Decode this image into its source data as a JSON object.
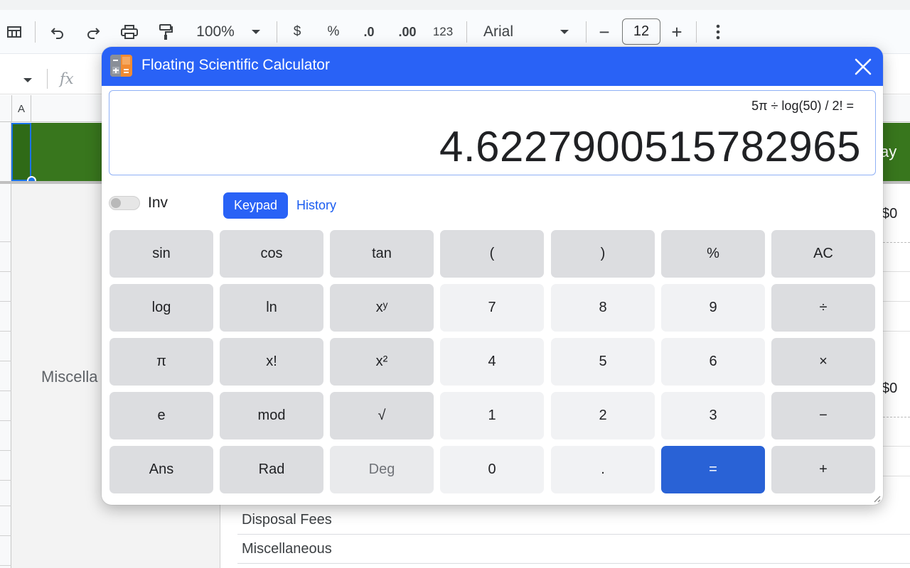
{
  "toolbar": {
    "zoom": "100%",
    "currency": "$",
    "percent": "%",
    "decrease_decimal": ".0",
    "increase_decimal": ".00",
    "number_format": "123",
    "font": "Arial",
    "font_size": "12",
    "minus": "−",
    "plus": "+"
  },
  "formula_bar": {
    "fx": "fx"
  },
  "sheet": {
    "column_a": "A",
    "misc_left": "Miscella",
    "green_right_text": "ay",
    "dollar_1": "$0",
    "dollar_2": "$0",
    "rows": [
      "Disposal Fees",
      "Miscellaneous"
    ]
  },
  "calculator": {
    "title": "Floating Scientific Calculator",
    "expression": "5π ÷ log(50) / 2! =",
    "result": "4.6227900515782965",
    "inv_label": "Inv",
    "inv_enabled": false,
    "tabs": {
      "keypad": "Keypad",
      "history": "History"
    },
    "keys": [
      [
        "sin",
        "cos",
        "tan",
        "(",
        ")",
        "%",
        "AC"
      ],
      [
        "log",
        "ln",
        "xʸ",
        "7",
        "8",
        "9",
        "÷"
      ],
      [
        "π",
        "x!",
        "x²",
        "4",
        "5",
        "6",
        "×"
      ],
      [
        "e",
        "mod",
        "√",
        "1",
        "2",
        "3",
        "−"
      ],
      [
        "Ans",
        "Rad",
        "Deg",
        "0",
        ".",
        "=",
        "+"
      ]
    ],
    "accent_color": "#2962f6",
    "equals_color": "#2962d6"
  }
}
